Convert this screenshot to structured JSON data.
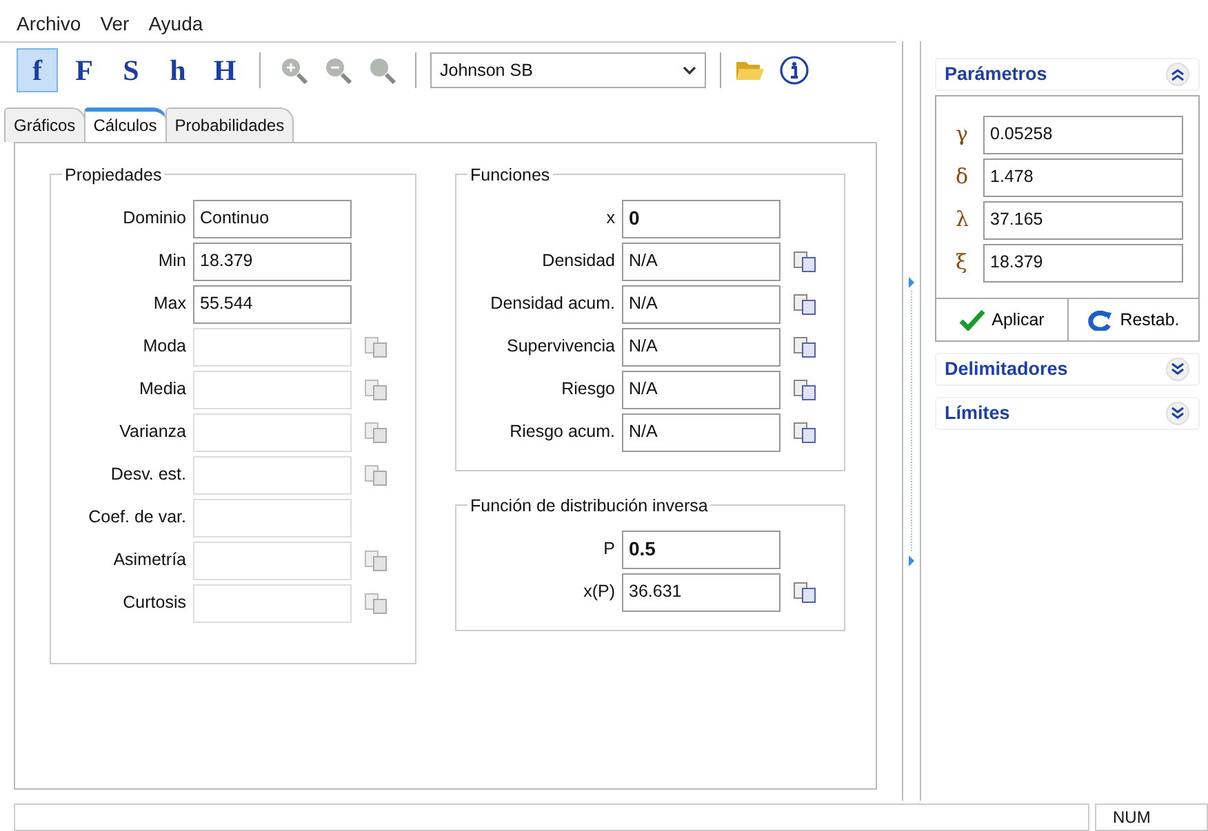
{
  "menu": [
    "Archivo",
    "Ver",
    "Ayuda"
  ],
  "toolbar": {
    "modes": [
      {
        "label": "f",
        "selected": true
      },
      {
        "label": "F",
        "selected": false
      },
      {
        "label": "S",
        "selected": false
      },
      {
        "label": "h",
        "selected": false
      },
      {
        "label": "H",
        "selected": false
      }
    ],
    "zoom_disabled": true,
    "distribution": "Johnson SB"
  },
  "tabs": [
    {
      "label": "Gráficos",
      "selected": false
    },
    {
      "label": "Cálculos",
      "selected": true
    },
    {
      "label": "Probabilidades",
      "selected": false
    }
  ],
  "properties": {
    "title": "Propiedades",
    "rows": [
      {
        "label": "Dominio",
        "value": "Continuo",
        "disabled": false,
        "copy": false
      },
      {
        "label": "Min",
        "value": "18.379",
        "disabled": false,
        "copy": false
      },
      {
        "label": "Max",
        "value": "55.544",
        "disabled": false,
        "copy": false
      },
      {
        "label": "Moda",
        "disabled": true,
        "copy": true
      },
      {
        "label": "Media",
        "disabled": true,
        "copy": true
      },
      {
        "label": "Varianza",
        "disabled": true,
        "copy": true
      },
      {
        "label": "Desv. est.",
        "disabled": true,
        "copy": true
      },
      {
        "label": "Coef. de var.",
        "disabled": true,
        "copy": false
      },
      {
        "label": "Asimetría",
        "disabled": true,
        "copy": true
      },
      {
        "label": "Curtosis",
        "disabled": true,
        "copy": true
      }
    ]
  },
  "functions": {
    "title": "Funciones",
    "rows": [
      {
        "kind": "input",
        "label": "x",
        "value": "0"
      },
      {
        "kind": "output",
        "label": "Densidad",
        "value": "N/A"
      },
      {
        "kind": "output",
        "label": "Densidad acum.",
        "value": "N/A"
      },
      {
        "kind": "output",
        "label": "Supervivencia",
        "value": "N/A"
      },
      {
        "kind": "output",
        "label": "Riesgo",
        "value": "N/A"
      },
      {
        "kind": "output",
        "label": "Riesgo acum.",
        "value": "N/A"
      }
    ]
  },
  "inverse": {
    "title": "Función de distribución inversa",
    "rows": [
      {
        "kind": "input",
        "label": "P",
        "value": "0.5"
      },
      {
        "kind": "output",
        "label": "x(P)",
        "value": "36.631"
      }
    ]
  },
  "side_panel": {
    "sections": [
      {
        "title": "Parámetros",
        "expanded": true,
        "params": [
          {
            "symbol": "γ",
            "value": "0.05258"
          },
          {
            "symbol": "δ",
            "value": "1.478"
          },
          {
            "symbol": "λ",
            "value": "37.165"
          },
          {
            "symbol": "ξ",
            "value": "18.379"
          }
        ],
        "buttons": [
          "Aplicar",
          "Restab."
        ]
      },
      {
        "title": "Delimitadores",
        "expanded": false
      },
      {
        "title": "Límites",
        "expanded": false
      }
    ]
  },
  "status_bar": {
    "indicator": "NUM"
  }
}
